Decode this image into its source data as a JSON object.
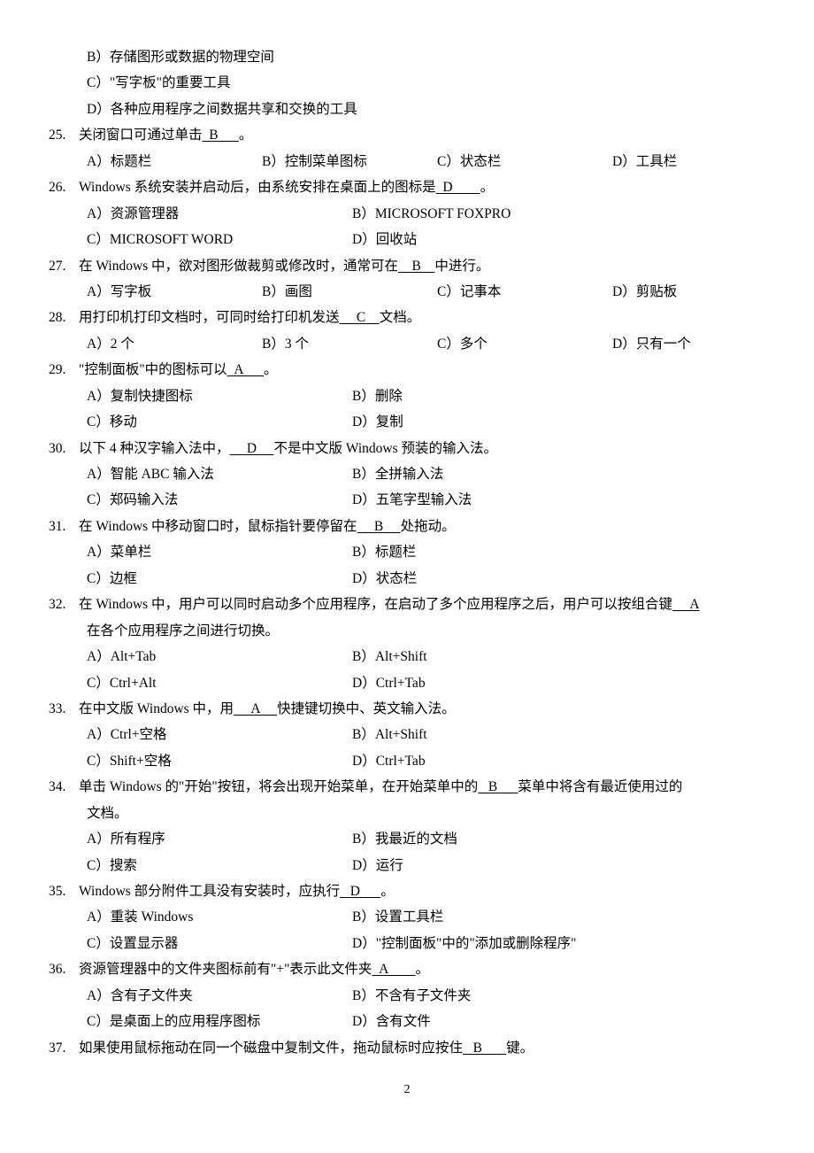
{
  "partial_options": [
    "B）存储图形或数据的物理空间",
    "C）\"写字板\"的重要工具",
    "D）各种应用程序之间数据共享和交换的工具"
  ],
  "questions": [
    {
      "num": "25.",
      "stem_parts": [
        "关闭窗口可通过单击",
        "  B      ",
        "。"
      ],
      "options_layout": "inline4",
      "options": [
        "A）标题栏",
        "B）控制菜单图标",
        "C）状态栏",
        "D）工具栏"
      ]
    },
    {
      "num": "26.",
      "stem_parts": [
        "Windows 系统安装并启动后，由系统安排在桌面上的图标是",
        "  D        ",
        "。"
      ],
      "options_layout": "2col",
      "options": [
        "A）资源管理器",
        "B）MICROSOFT  FOXPRO",
        "C）MICROSOFT  WORD",
        "D）回收站"
      ]
    },
    {
      "num": "27.",
      "stem_parts": [
        "在 Windows 中，欲对图形做裁剪或修改时，通常可在",
        "    B    ",
        "中进行。"
      ],
      "options_layout": "inline4",
      "options": [
        "A）写字板",
        "B）画图",
        "C）记事本",
        "D）剪贴板"
      ]
    },
    {
      "num": "28.",
      "stem_parts": [
        "用打印机打印文档时，可同时给打印机发送",
        "     C    ",
        "文档。"
      ],
      "options_layout": "inline4",
      "options": [
        "A）2 个",
        "B）3 个",
        "C）多个",
        "D）只有一个"
      ]
    },
    {
      "num": "29.",
      "stem_parts": [
        "\"控制面板\"中的图标可以",
        "  A      ",
        "。"
      ],
      "options_layout": "2col",
      "options": [
        "A）复制快捷图标",
        "B）删除",
        "C）移动",
        "D）复制"
      ]
    },
    {
      "num": "30.",
      "stem_parts": [
        "以下 4 种汉字输入法中，",
        "     D     ",
        "不是中文版 Windows 预装的输入法。"
      ],
      "options_layout": "2col",
      "options": [
        "A）智能 ABC 输入法",
        "B）全拼输入法",
        "C）郑码输入法",
        "D）五笔字型输入法"
      ]
    },
    {
      "num": "31.",
      "stem_parts": [
        "在 Windows 中移动窗口时，鼠标指针要停留在",
        "     B     ",
        "处拖动。"
      ],
      "options_layout": "2col",
      "options": [
        "A）菜单栏",
        "B）标题栏",
        "C）边框",
        "D）状态栏"
      ]
    },
    {
      "num": "32.",
      "stem_parts": [
        "在 Windows 中，用户可以同时启动多个应用程序，在启动了多个应用程序之后，用户可以按组合键",
        "     A"
      ],
      "continuation": "在各个应用程序之间进行切换。",
      "options_layout": "2col",
      "options": [
        "A）Alt+Tab",
        "B）Alt+Shift",
        "C）Ctrl+Alt",
        "D）Ctrl+Tab"
      ]
    },
    {
      "num": "33.",
      "stem_parts": [
        "在中文版 Windows 中，用",
        "     A     ",
        "快捷键切换中、英文输入法。"
      ],
      "options_layout": "2col",
      "options": [
        "A）Ctrl+空格",
        "B）Alt+Shift",
        "C）Shift+空格",
        "D）Ctrl+Tab"
      ]
    },
    {
      "num": "34.",
      "stem_parts": [
        "单击 Windows 的\"开始\"按钮，将会出现开始菜单，在开始菜单中的",
        "   B      ",
        "菜单中将含有最近使用过的"
      ],
      "continuation": "文档。",
      "options_layout": "2col",
      "options": [
        "A）所有程序",
        "B）我最近的文档",
        "C）搜索",
        "D）运行"
      ]
    },
    {
      "num": "35.",
      "stem_parts": [
        "Windows 部分附件工具没有安装时，应执行",
        "   D      ",
        "。"
      ],
      "options_layout": "2col",
      "options": [
        "A）重装 Windows",
        "B）设置工具栏",
        "C）设置显示器",
        "D）\"控制面板\"中的\"添加或删除程序\""
      ]
    },
    {
      "num": "36.",
      "stem_parts": [
        "资源管理器中的文件夹图标前有\"+\"表示此文件夹",
        "  A        ",
        "。"
      ],
      "options_layout": "2col",
      "options": [
        "A）含有子文件夹",
        "B）不含有子文件夹",
        "C）是桌面上的应用程序图标",
        "D）含有文件"
      ]
    },
    {
      "num": "37.",
      "stem_parts": [
        "如果使用鼠标拖动在同一个磁盘中复制文件，拖动鼠标时应按住",
        "   B       ",
        "键。"
      ],
      "options_layout": "none",
      "options": []
    }
  ],
  "page_number": "2"
}
